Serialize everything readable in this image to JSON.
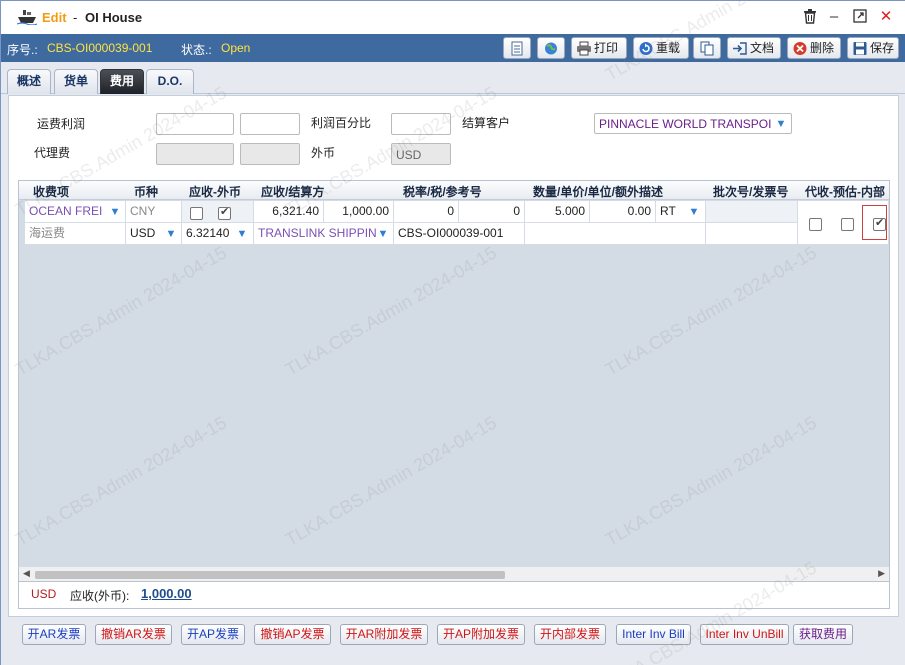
{
  "window": {
    "mode": "Edit",
    "separator": "-",
    "title": "OI House",
    "controls": [
      "trash-icon",
      "minimize-icon",
      "maximize-icon",
      "close-icon"
    ]
  },
  "infobar": {
    "serial_label": "序号.:",
    "serial_value": "CBS-OI000039-001",
    "status_label": "状态.:",
    "status_value": "Open"
  },
  "toolbar": {
    "print": "打印",
    "reload": "重载",
    "docs": "文档",
    "delete": "删除",
    "save": "保存"
  },
  "tabs": [
    {
      "label": "概述",
      "active": false
    },
    {
      "label": "货单",
      "active": false
    },
    {
      "label": "费用",
      "active": true
    },
    {
      "label": "D.O.",
      "active": false
    }
  ],
  "form": {
    "freight_profit_label": "运费利润",
    "profit_pct_label": "利润百分比",
    "settle_customer_label": "结算客户",
    "settle_customer_value": "PINNACLE WORLD TRANSPOI",
    "agent_fee_label": "代理费",
    "foreign_currency_label": "外币",
    "foreign_currency_placeholder": "USD"
  },
  "grid": {
    "headers": [
      "收费项",
      "币种",
      "应收-外币",
      "应收/结算方",
      "税率/税/参考号",
      "数量/单价/单位/额外描述",
      "批次号/发票号",
      "代收-预估-内部"
    ],
    "row": {
      "charge_item": "OCEAN FREI",
      "charge_item_desc": "海运费",
      "currency": "CNY",
      "currency2": "USD",
      "rate": "6.32140",
      "amount_local": "6,321.40",
      "amount_foreign": "1,000.00",
      "settle_party": "TRANSLINK SHIPPIN",
      "tax_rate": "0",
      "tax": "0",
      "ref_no": "CBS-OI000039-001",
      "quantity": "5.000",
      "unit_price": "0.00",
      "unit": "RT",
      "recv_foreign_checked": false,
      "recv_local_checked": true,
      "collect_checked": false,
      "estimate_checked": false,
      "internal_checked": true
    }
  },
  "summary": {
    "currency": "USD",
    "label": "应收(外币):",
    "value": "1,000.00"
  },
  "bottom_buttons": [
    {
      "label": "开AR发票",
      "color": "#1a3ec0"
    },
    {
      "label": "撤销AR发票",
      "color": "#d01515"
    },
    {
      "label": "开AP发票",
      "color": "#1a3ec0"
    },
    {
      "label": "撤销AP发票",
      "color": "#d01515"
    },
    {
      "label": "开AR附加发票",
      "color": "#d01515"
    },
    {
      "label": "开AP附加发票",
      "color": "#d01515"
    },
    {
      "label": "开内部发票",
      "color": "#d01515"
    },
    {
      "label": "Inter Inv Bill",
      "color": "#1a3ec0"
    },
    {
      "label": "Inter Inv UnBill",
      "color": "#d01515"
    },
    {
      "label": "获取费用",
      "color": "#6a1f8a"
    }
  ],
  "watermark": "TLKA.CBS.Admin 2024-04-15"
}
